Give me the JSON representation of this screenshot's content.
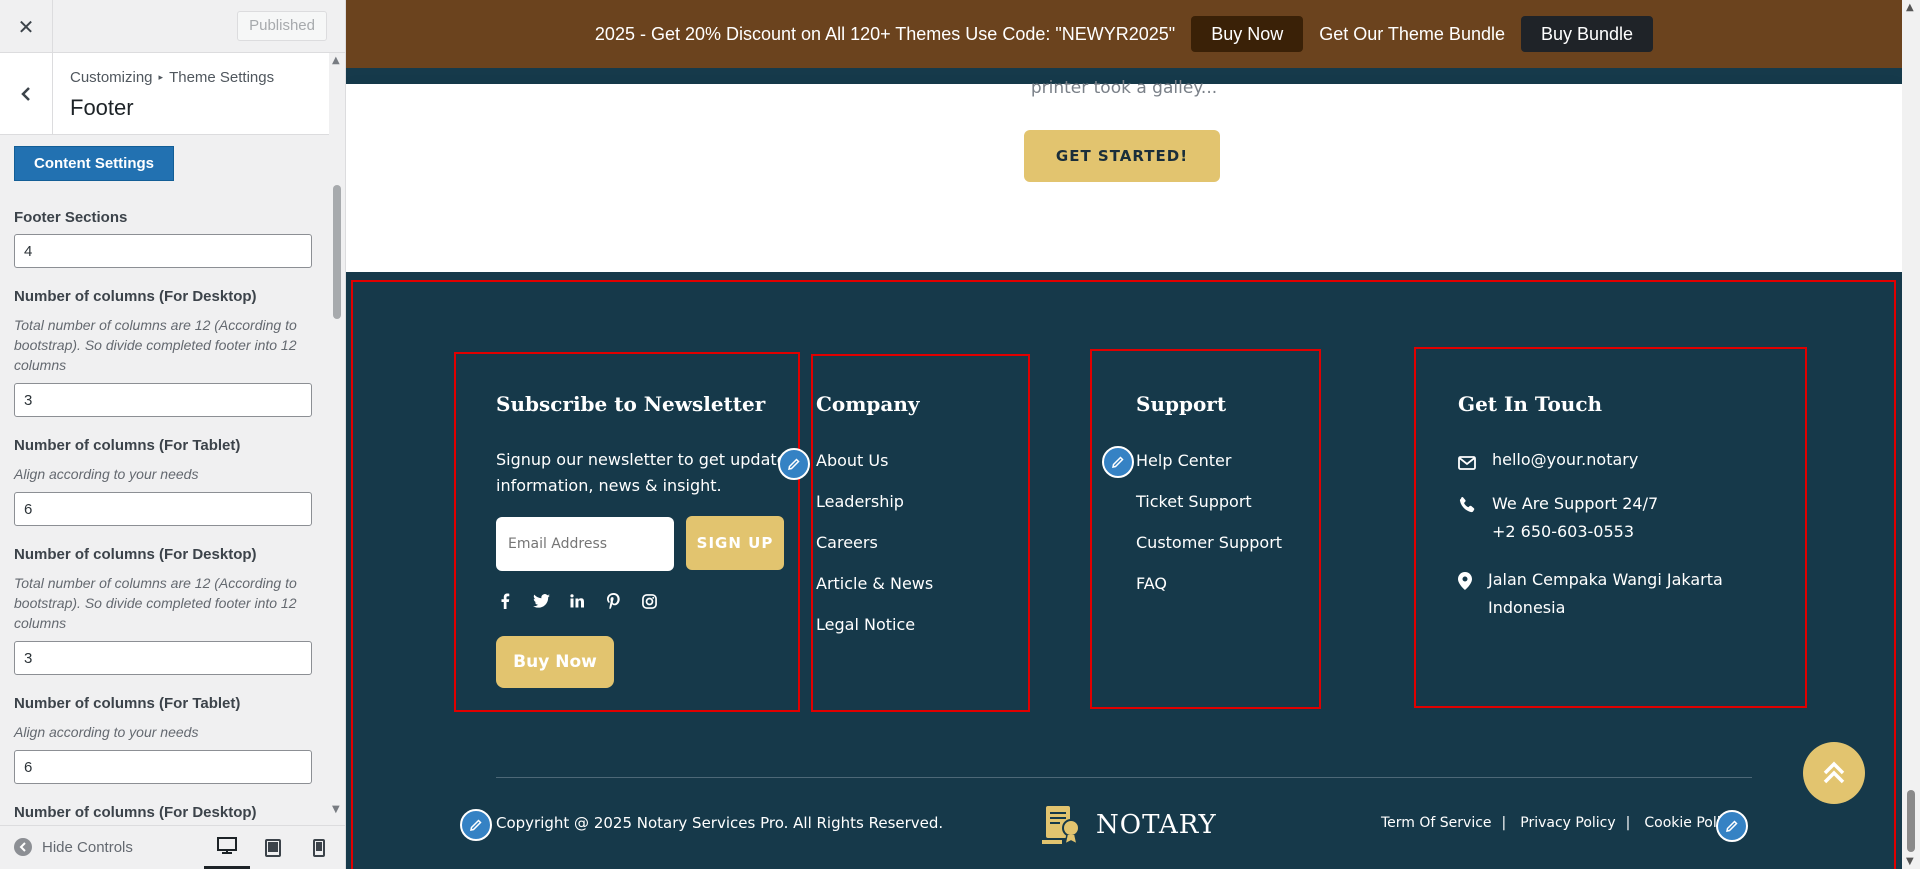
{
  "sidebar": {
    "published_label": "Published",
    "breadcrumb_root": "Customizing",
    "breadcrumb_parent": "Theme Settings",
    "section_title": "Footer",
    "content_settings_label": "Content Settings",
    "fields": [
      {
        "label": "Footer Sections",
        "desc": "",
        "value": "4"
      },
      {
        "label": "Number of columns (For Desktop)",
        "desc": "Total number of columns are 12 (According to bootstrap). So divide completed footer into 12 columns",
        "value": "3"
      },
      {
        "label": "Number of columns (For Tablet)",
        "desc": "Align according to your needs",
        "value": "6"
      },
      {
        "label": "Number of columns (For Desktop)",
        "desc": "Total number of columns are 12 (According to bootstrap). So divide completed footer into 12 columns",
        "value": "3"
      },
      {
        "label": "Number of columns (For Tablet)",
        "desc": "Align according to your needs",
        "value": "6"
      },
      {
        "label": "Number of columns (For Desktop)",
        "desc": "",
        "value": ""
      }
    ],
    "hide_controls_label": "Hide Controls"
  },
  "promo": {
    "text": "2025 - Get 20% Discount on All 120+ Themes Use Code: \"NEWYR2025\"",
    "buy_now": "Buy Now",
    "bundle_text": "Get Our Theme Bundle",
    "buy_bundle": "Buy Bundle"
  },
  "hero": {
    "subtitle_fragment": "printer took a galley...",
    "cta": "GET STARTED!"
  },
  "footer": {
    "newsletter": {
      "title": "Subscribe to Newsletter",
      "text": "Signup our newsletter to get update information, news & insight.",
      "email_placeholder": "Email Address",
      "signup": "SIGN UP",
      "buy_now": "Buy Now"
    },
    "company": {
      "title": "Company",
      "links": [
        "About Us",
        "Leadership",
        "Careers",
        "Article & News",
        "Legal Notice"
      ]
    },
    "support": {
      "title": "Support",
      "links": [
        "Help Center",
        "Ticket Support",
        "Customer Support",
        "FAQ"
      ]
    },
    "contact": {
      "title": "Get In Touch",
      "email": "hello@your.notary",
      "phone_line1": "We Are Support 24/7",
      "phone_line2": "+2 650-603-0553",
      "address_line1": "Jalan Cempaka Wangi Jakarta",
      "address_line2": "Indonesia"
    },
    "copyright": "Copyright @ 2025 Notary Services Pro. All Rights Reserved.",
    "logo_text": "NOTARY",
    "legal_links": [
      "Term Of Service",
      "Privacy Policy",
      "Cookie Policy"
    ]
  },
  "colors": {
    "accent_gold": "#e2c46f",
    "footer_bg": "#16394a",
    "promo_bg": "#6b431e",
    "wp_blue": "#2271b1"
  }
}
